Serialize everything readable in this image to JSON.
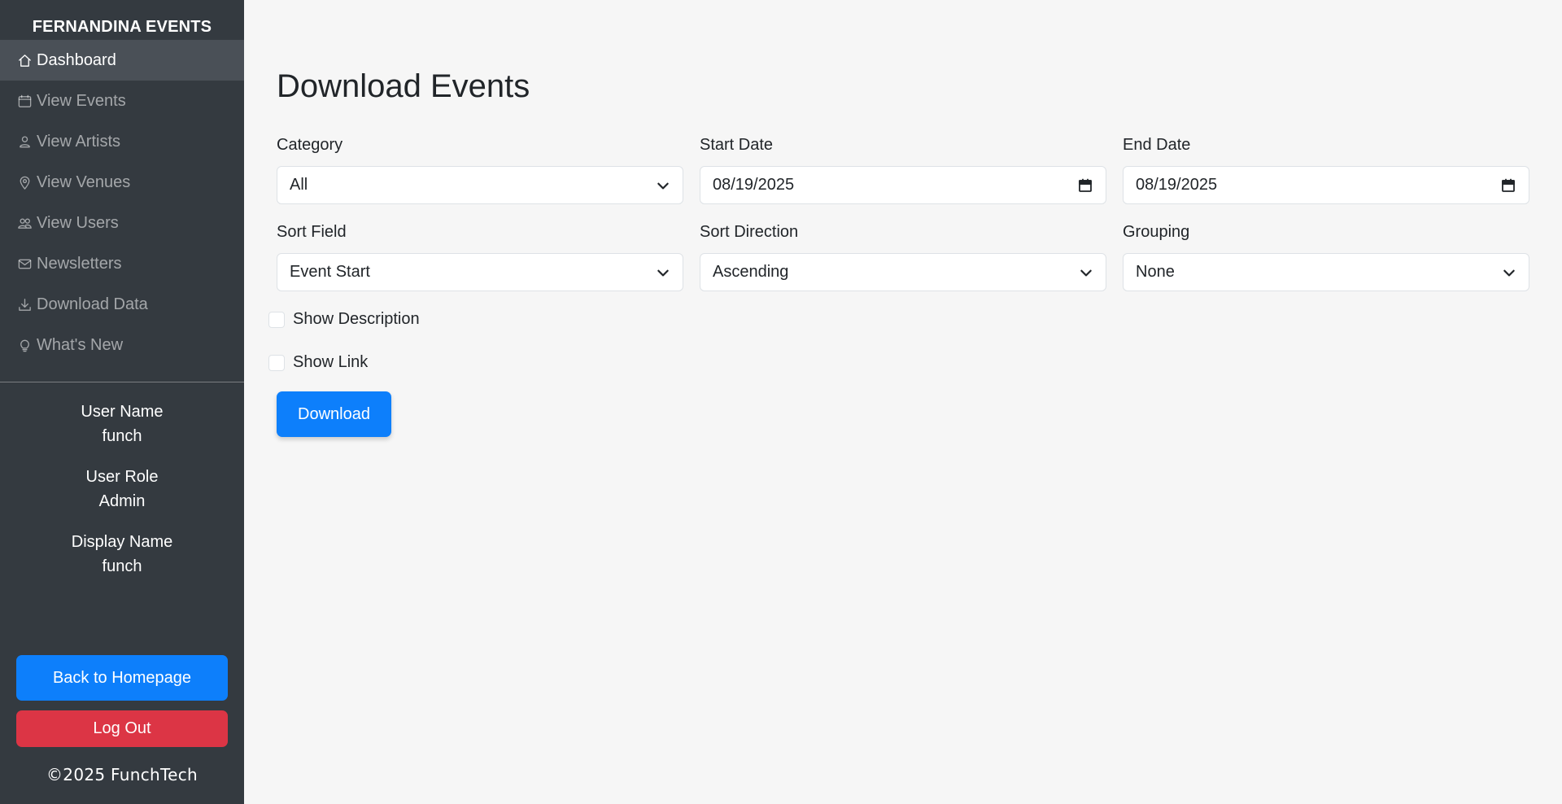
{
  "sidebar": {
    "brand": "FERNANDINA EVENTS",
    "items": [
      {
        "label": "Dashboard",
        "icon": "house-icon",
        "active": true
      },
      {
        "label": "View Events",
        "icon": "calendar-icon",
        "active": false
      },
      {
        "label": "View Artists",
        "icon": "person-icon",
        "active": false
      },
      {
        "label": "View Venues",
        "icon": "map-pin-icon",
        "active": false
      },
      {
        "label": "View Users",
        "icon": "people-icon",
        "active": false
      },
      {
        "label": "Newsletters",
        "icon": "envelope-icon",
        "active": false
      },
      {
        "label": "Download Data",
        "icon": "download-icon",
        "active": false
      },
      {
        "label": "What's New",
        "icon": "lightbulb-icon",
        "active": false
      }
    ],
    "user": {
      "name_label": "User Name",
      "name_value": "funch",
      "role_label": "User Role",
      "role_value": "Admin",
      "display_label": "Display Name",
      "display_value": "funch"
    },
    "back_label": "Back to Homepage",
    "logout_label": "Log Out",
    "copyright": "©2025 FunchTech",
    "colors": {
      "sidebar_bg": "#343a40",
      "primary": "#0d7ffb",
      "danger": "#dc3545"
    }
  },
  "main": {
    "title": "Download Events",
    "category": {
      "label": "Category",
      "value": "All"
    },
    "start_date": {
      "label": "Start Date",
      "value": "08/19/2025"
    },
    "end_date": {
      "label": "End Date",
      "value": "08/19/2025"
    },
    "sort_field": {
      "label": "Sort Field",
      "value": "Event Start"
    },
    "sort_direction": {
      "label": "Sort Direction",
      "value": "Ascending"
    },
    "grouping": {
      "label": "Grouping",
      "value": "None"
    },
    "show_description": {
      "label": "Show Description",
      "checked": false
    },
    "show_link": {
      "label": "Show Link",
      "checked": false
    },
    "download_label": "Download"
  }
}
